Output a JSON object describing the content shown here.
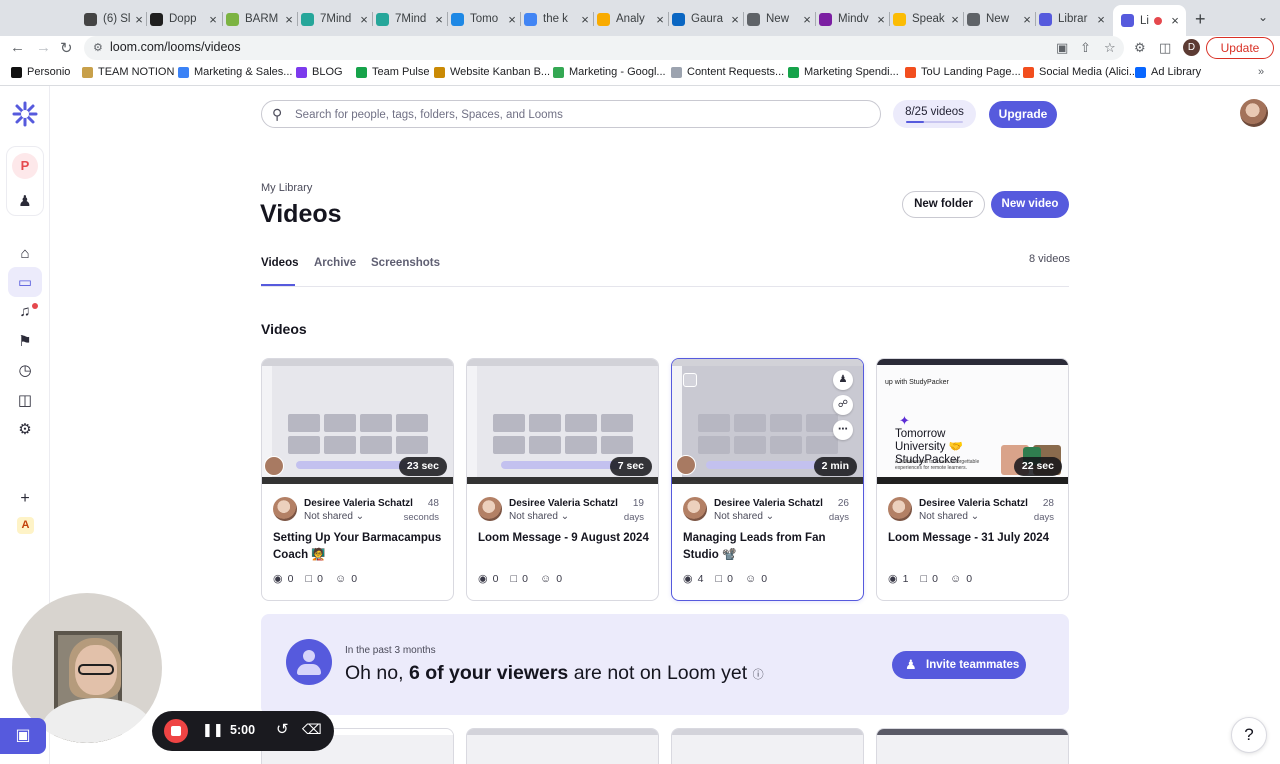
{
  "browser": {
    "tabs": [
      {
        "label": "(6) Sl",
        "color": "#444444"
      },
      {
        "label": "Dopp",
        "color": "#1f1f1f"
      },
      {
        "label": "BARM",
        "color": "#7cb342"
      },
      {
        "label": "7Mind",
        "color": "#26a69a"
      },
      {
        "label": "7Mind",
        "color": "#26a69a"
      },
      {
        "label": "Tomo",
        "color": "#1e88e5"
      },
      {
        "label": "the k",
        "color": "#4285f4"
      },
      {
        "label": "Analy",
        "color": "#f9ab00"
      },
      {
        "label": "Gaura",
        "color": "#0a66c2"
      },
      {
        "label": "New",
        "color": "#5f6368"
      },
      {
        "label": "Mindv",
        "color": "#7b1fa2"
      },
      {
        "label": "Speak",
        "color": "#fbbc04"
      },
      {
        "label": "New",
        "color": "#5f6368"
      },
      {
        "label": "Librar",
        "color": "#565add"
      },
      {
        "label": "Li",
        "color": "#565add"
      }
    ],
    "url": "loom.com/looms/videos",
    "update_label": "Update",
    "profile_initial": "D",
    "bookmarks": [
      {
        "label": "Personio",
        "color": "#111111"
      },
      {
        "label": "TEAM NOTION",
        "color": "#c8a04a"
      },
      {
        "label": "Marketing & Sales...",
        "color": "#3b82f6"
      },
      {
        "label": "BLOG",
        "color": "#7c3aed"
      },
      {
        "label": "Team Pulse",
        "color": "#16a34a"
      },
      {
        "label": "Website Kanban B...",
        "color": "#ca8a04"
      },
      {
        "label": "Marketing - Googl...",
        "color": "#34a853"
      },
      {
        "label": "Content Requests...",
        "color": "#9ca3af"
      },
      {
        "label": "Marketing Spendi...",
        "color": "#16a34a"
      },
      {
        "label": "ToU Landing Page...",
        "color": "#f24e1e"
      },
      {
        "label": "Social Media (Alici...",
        "color": "#f24e1e"
      },
      {
        "label": "Ad Library",
        "color": "#0866ff"
      }
    ]
  },
  "sidebar": {
    "workspace_initial": "P",
    "workspace2_initial": "A"
  },
  "header": {
    "search_placeholder": "Search for people, tags, folders, Spaces, and Looms",
    "quota_label": "8/25 videos",
    "quota_fraction": 0.32,
    "upgrade_label": "Upgrade"
  },
  "library": {
    "breadcrumb": "My Library",
    "title": "Videos",
    "new_folder_label": "New folder",
    "new_video_label": "New video",
    "tabs": [
      "Videos",
      "Archive",
      "Screenshots"
    ],
    "count_label": "8 videos",
    "section_title": "Videos"
  },
  "videos": [
    {
      "duration": "23 sec",
      "author": "Desiree Valeria Schatzl",
      "age_num": "48",
      "age_unit": "seconds",
      "shared": "Not shared",
      "title": "Setting Up Your Barmacampus Coach 🧑‍🏫",
      "views": "0",
      "comments": "0",
      "reactions": "0"
    },
    {
      "duration": "7 sec",
      "author": "Desiree Valeria Schatzl",
      "age_num": "19",
      "age_unit": "days",
      "shared": "Not shared",
      "title": "Loom Message - 9 August 2024",
      "views": "0",
      "comments": "0",
      "reactions": "0"
    },
    {
      "duration": "2 min",
      "author": "Desiree Valeria Schatzl",
      "age_num": "26",
      "age_unit": "days",
      "shared": "Not shared",
      "title": "Managing Leads from Fan Studio 📽️",
      "views": "4",
      "comments": "0",
      "reactions": "0"
    },
    {
      "duration": "22 sec",
      "author": "Desiree Valeria Schatzl",
      "age_num": "28",
      "age_unit": "days",
      "shared": "Not shared",
      "title": "Loom Message - 31 July 2024",
      "views": "1",
      "comments": "0",
      "reactions": "0",
      "thumb_heading": "up with StudyPacker",
      "thumb_brand": "Tomorrow University 🤝 StudyPacker",
      "thumb_sub": "A collaboration to create unforgettable experiences for remote learners."
    }
  ],
  "banner": {
    "small": "In the past 3 months",
    "prefix": "Oh no, ",
    "bold": "6 of your viewers",
    "suffix": " are not on Loom yet",
    "invite_label": "Invite teammates"
  },
  "recorder": {
    "timer": "5:00"
  },
  "help_label": "?"
}
